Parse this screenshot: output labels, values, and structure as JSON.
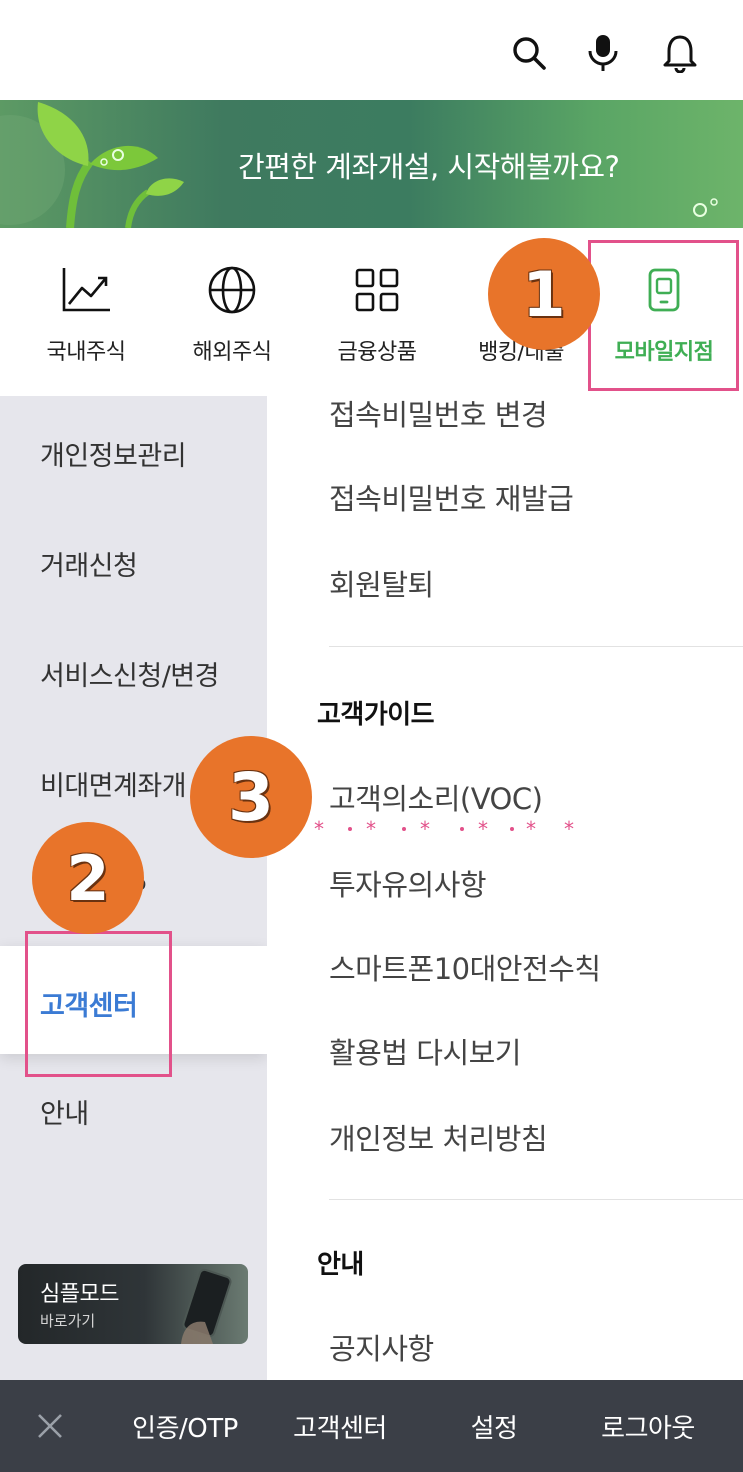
{
  "top_bar": {
    "icons": [
      "search-icon",
      "microphone-icon",
      "bell-icon"
    ]
  },
  "banner": {
    "text": "간편한 계좌개설, 시작해볼까요?"
  },
  "quick_nav": {
    "items": [
      {
        "label": "국내주식",
        "icon": "chart-line-icon"
      },
      {
        "label": "해외주식",
        "icon": "globe-icon"
      },
      {
        "label": "금융상품",
        "icon": "grid-icon"
      },
      {
        "label": "뱅킹/대출",
        "icon": "bank-icon"
      },
      {
        "label": "모바일지점",
        "icon": "mobile-icon",
        "active": true
      }
    ],
    "active_color": "#3fae54"
  },
  "left_menu": {
    "items": [
      "개인정보관리",
      "거래신청",
      "서비스신청/변경",
      "비대면계좌개",
      "P",
      "고객센터",
      "안내"
    ],
    "active_index": 5,
    "active_color": "#3b7bd4",
    "simple_mode": {
      "title": "심플모드",
      "subtitle": "바로가기"
    }
  },
  "right_panel": {
    "top_items": [
      "접속비밀번호 변경",
      "접속비밀번호 재발급",
      "회원탈퇴"
    ],
    "guide_heading": "고객가이드",
    "guide_items": [
      "고객의소리(VOC)",
      "투자유의사항",
      "스마트폰10대안전수칙",
      "활용법 다시보기",
      "개인정보 처리방침"
    ],
    "info_heading": "안내",
    "info_items": [
      "공지사항"
    ]
  },
  "bottom_bar": {
    "items": [
      "인증/OTP",
      "고객센터",
      "설정",
      "로그아웃"
    ],
    "close_icon": "close-icon"
  },
  "annotations": {
    "badges": [
      "1",
      "2",
      "3"
    ],
    "color": "#e8742a",
    "highlight_color": "#e2518a"
  }
}
